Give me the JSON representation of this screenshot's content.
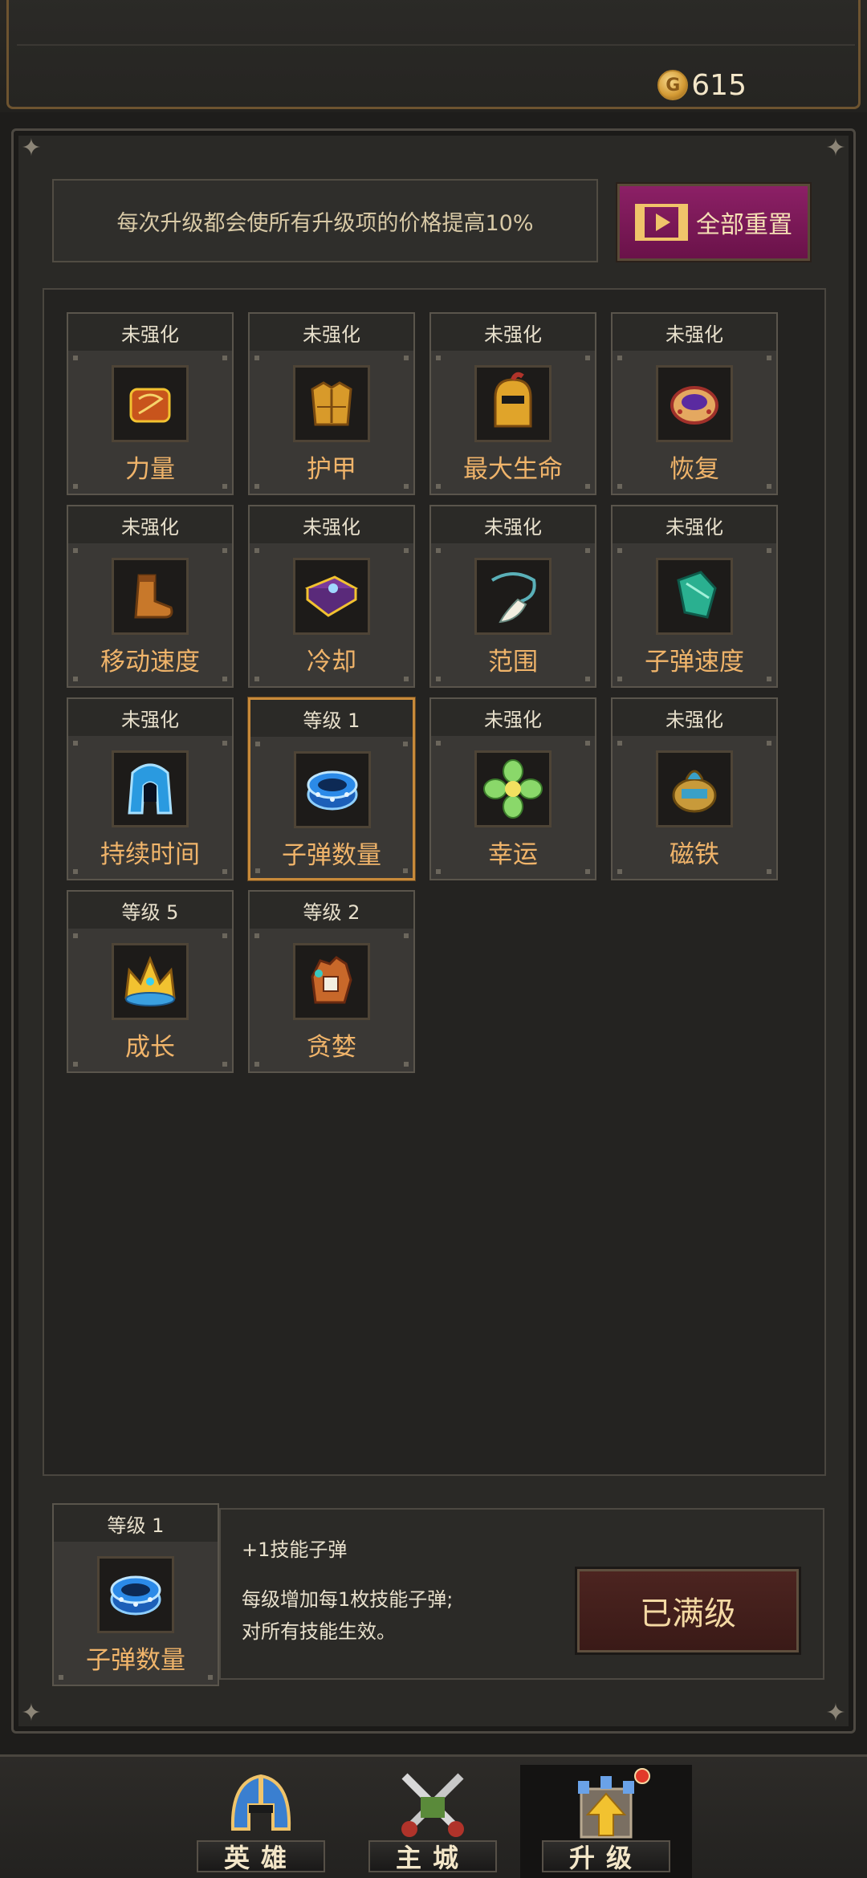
{
  "header": {
    "coin_symbol": "G",
    "coins": "615"
  },
  "notice": "每次升级都会使所有升级项的价格提高10%",
  "reset_button": {
    "label": "全部重置",
    "icon": "video-ad-icon",
    "color": "#8c2066"
  },
  "upgrades": [
    {
      "status": "未强化",
      "name": "力量",
      "icon": "bracer-icon",
      "selected": false
    },
    {
      "status": "未强化",
      "name": "护甲",
      "icon": "armor-icon",
      "selected": false
    },
    {
      "status": "未强化",
      "name": "最大生命",
      "icon": "helmet-icon",
      "selected": false
    },
    {
      "status": "未强化",
      "name": "恢复",
      "icon": "ring-icon",
      "selected": false
    },
    {
      "status": "未强化",
      "name": "移动速度",
      "icon": "boots-icon",
      "selected": false
    },
    {
      "status": "未强化",
      "name": "冷却",
      "icon": "spellbook-icon",
      "selected": false
    },
    {
      "status": "未强化",
      "name": "范围",
      "icon": "tooth-necklace-icon",
      "selected": false
    },
    {
      "status": "未强化",
      "name": "子弹速度",
      "icon": "gauntlet-icon",
      "selected": false
    },
    {
      "status": "未强化",
      "name": "持续时间",
      "icon": "hood-icon",
      "selected": false
    },
    {
      "status": "等级 1",
      "name": "子弹数量",
      "icon": "blue-bracelet-icon",
      "selected": true
    },
    {
      "status": "未强化",
      "name": "幸运",
      "icon": "clover-flower-icon",
      "selected": false
    },
    {
      "status": "未强化",
      "name": "磁铁",
      "icon": "magnet-urn-icon",
      "selected": false
    },
    {
      "status": "等级 5",
      "name": "成长",
      "icon": "crown-icon",
      "selected": false
    },
    {
      "status": "等级 2",
      "name": "贪婪",
      "icon": "glove-icon",
      "selected": false
    }
  ],
  "detail": {
    "status": "等级 1",
    "name": "子弹数量",
    "icon": "blue-bracelet-icon",
    "title": "+1技能子弹",
    "desc_line1": "每级增加每1枚技能子弹;",
    "desc_line2": "对所有技能生效。",
    "button_label": "已满级"
  },
  "nav": {
    "tabs": [
      {
        "label": "英雄",
        "icon": "hero-helmet-icon",
        "active": false
      },
      {
        "label": "主城",
        "icon": "crossed-swords-icon",
        "active": false
      },
      {
        "label": "升级",
        "icon": "upgrade-castle-icon",
        "active": true,
        "badge": true
      }
    ]
  },
  "colors": {
    "accent_text": "#f0b46a",
    "selected_border": "#c88a3a",
    "badge": "#e23a2a"
  }
}
